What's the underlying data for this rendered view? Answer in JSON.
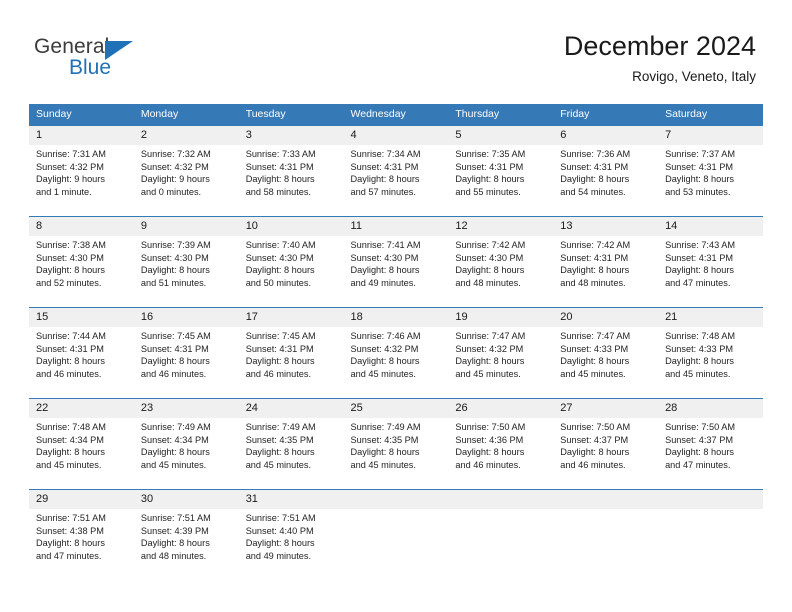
{
  "brand": {
    "name_part1": "General",
    "name_part2": "Blue",
    "accent_color": "#1f71b8",
    "triangle_icon": "triangle-icon"
  },
  "header": {
    "title": "December 2024",
    "subtitle": "Rovigo, Veneto, Italy"
  },
  "calendar": {
    "header_bg": "#3679b7",
    "daynum_bg": "#f0f0f0",
    "weekdays": [
      "Sunday",
      "Monday",
      "Tuesday",
      "Wednesday",
      "Thursday",
      "Friday",
      "Saturday"
    ],
    "weeks": [
      [
        {
          "day": "1",
          "sunrise": "Sunrise: 7:31 AM",
          "sunset": "Sunset: 4:32 PM",
          "daylight_line1": "Daylight: 9 hours",
          "daylight_line2": "and 1 minute."
        },
        {
          "day": "2",
          "sunrise": "Sunrise: 7:32 AM",
          "sunset": "Sunset: 4:32 PM",
          "daylight_line1": "Daylight: 9 hours",
          "daylight_line2": "and 0 minutes."
        },
        {
          "day": "3",
          "sunrise": "Sunrise: 7:33 AM",
          "sunset": "Sunset: 4:31 PM",
          "daylight_line1": "Daylight: 8 hours",
          "daylight_line2": "and 58 minutes."
        },
        {
          "day": "4",
          "sunrise": "Sunrise: 7:34 AM",
          "sunset": "Sunset: 4:31 PM",
          "daylight_line1": "Daylight: 8 hours",
          "daylight_line2": "and 57 minutes."
        },
        {
          "day": "5",
          "sunrise": "Sunrise: 7:35 AM",
          "sunset": "Sunset: 4:31 PM",
          "daylight_line1": "Daylight: 8 hours",
          "daylight_line2": "and 55 minutes."
        },
        {
          "day": "6",
          "sunrise": "Sunrise: 7:36 AM",
          "sunset": "Sunset: 4:31 PM",
          "daylight_line1": "Daylight: 8 hours",
          "daylight_line2": "and 54 minutes."
        },
        {
          "day": "7",
          "sunrise": "Sunrise: 7:37 AM",
          "sunset": "Sunset: 4:31 PM",
          "daylight_line1": "Daylight: 8 hours",
          "daylight_line2": "and 53 minutes."
        }
      ],
      [
        {
          "day": "8",
          "sunrise": "Sunrise: 7:38 AM",
          "sunset": "Sunset: 4:30 PM",
          "daylight_line1": "Daylight: 8 hours",
          "daylight_line2": "and 52 minutes."
        },
        {
          "day": "9",
          "sunrise": "Sunrise: 7:39 AM",
          "sunset": "Sunset: 4:30 PM",
          "daylight_line1": "Daylight: 8 hours",
          "daylight_line2": "and 51 minutes."
        },
        {
          "day": "10",
          "sunrise": "Sunrise: 7:40 AM",
          "sunset": "Sunset: 4:30 PM",
          "daylight_line1": "Daylight: 8 hours",
          "daylight_line2": "and 50 minutes."
        },
        {
          "day": "11",
          "sunrise": "Sunrise: 7:41 AM",
          "sunset": "Sunset: 4:30 PM",
          "daylight_line1": "Daylight: 8 hours",
          "daylight_line2": "and 49 minutes."
        },
        {
          "day": "12",
          "sunrise": "Sunrise: 7:42 AM",
          "sunset": "Sunset: 4:30 PM",
          "daylight_line1": "Daylight: 8 hours",
          "daylight_line2": "and 48 minutes."
        },
        {
          "day": "13",
          "sunrise": "Sunrise: 7:42 AM",
          "sunset": "Sunset: 4:31 PM",
          "daylight_line1": "Daylight: 8 hours",
          "daylight_line2": "and 48 minutes."
        },
        {
          "day": "14",
          "sunrise": "Sunrise: 7:43 AM",
          "sunset": "Sunset: 4:31 PM",
          "daylight_line1": "Daylight: 8 hours",
          "daylight_line2": "and 47 minutes."
        }
      ],
      [
        {
          "day": "15",
          "sunrise": "Sunrise: 7:44 AM",
          "sunset": "Sunset: 4:31 PM",
          "daylight_line1": "Daylight: 8 hours",
          "daylight_line2": "and 46 minutes."
        },
        {
          "day": "16",
          "sunrise": "Sunrise: 7:45 AM",
          "sunset": "Sunset: 4:31 PM",
          "daylight_line1": "Daylight: 8 hours",
          "daylight_line2": "and 46 minutes."
        },
        {
          "day": "17",
          "sunrise": "Sunrise: 7:45 AM",
          "sunset": "Sunset: 4:31 PM",
          "daylight_line1": "Daylight: 8 hours",
          "daylight_line2": "and 46 minutes."
        },
        {
          "day": "18",
          "sunrise": "Sunrise: 7:46 AM",
          "sunset": "Sunset: 4:32 PM",
          "daylight_line1": "Daylight: 8 hours",
          "daylight_line2": "and 45 minutes."
        },
        {
          "day": "19",
          "sunrise": "Sunrise: 7:47 AM",
          "sunset": "Sunset: 4:32 PM",
          "daylight_line1": "Daylight: 8 hours",
          "daylight_line2": "and 45 minutes."
        },
        {
          "day": "20",
          "sunrise": "Sunrise: 7:47 AM",
          "sunset": "Sunset: 4:33 PM",
          "daylight_line1": "Daylight: 8 hours",
          "daylight_line2": "and 45 minutes."
        },
        {
          "day": "21",
          "sunrise": "Sunrise: 7:48 AM",
          "sunset": "Sunset: 4:33 PM",
          "daylight_line1": "Daylight: 8 hours",
          "daylight_line2": "and 45 minutes."
        }
      ],
      [
        {
          "day": "22",
          "sunrise": "Sunrise: 7:48 AM",
          "sunset": "Sunset: 4:34 PM",
          "daylight_line1": "Daylight: 8 hours",
          "daylight_line2": "and 45 minutes."
        },
        {
          "day": "23",
          "sunrise": "Sunrise: 7:49 AM",
          "sunset": "Sunset: 4:34 PM",
          "daylight_line1": "Daylight: 8 hours",
          "daylight_line2": "and 45 minutes."
        },
        {
          "day": "24",
          "sunrise": "Sunrise: 7:49 AM",
          "sunset": "Sunset: 4:35 PM",
          "daylight_line1": "Daylight: 8 hours",
          "daylight_line2": "and 45 minutes."
        },
        {
          "day": "25",
          "sunrise": "Sunrise: 7:49 AM",
          "sunset": "Sunset: 4:35 PM",
          "daylight_line1": "Daylight: 8 hours",
          "daylight_line2": "and 45 minutes."
        },
        {
          "day": "26",
          "sunrise": "Sunrise: 7:50 AM",
          "sunset": "Sunset: 4:36 PM",
          "daylight_line1": "Daylight: 8 hours",
          "daylight_line2": "and 46 minutes."
        },
        {
          "day": "27",
          "sunrise": "Sunrise: 7:50 AM",
          "sunset": "Sunset: 4:37 PM",
          "daylight_line1": "Daylight: 8 hours",
          "daylight_line2": "and 46 minutes."
        },
        {
          "day": "28",
          "sunrise": "Sunrise: 7:50 AM",
          "sunset": "Sunset: 4:37 PM",
          "daylight_line1": "Daylight: 8 hours",
          "daylight_line2": "and 47 minutes."
        }
      ],
      [
        {
          "day": "29",
          "sunrise": "Sunrise: 7:51 AM",
          "sunset": "Sunset: 4:38 PM",
          "daylight_line1": "Daylight: 8 hours",
          "daylight_line2": "and 47 minutes."
        },
        {
          "day": "30",
          "sunrise": "Sunrise: 7:51 AM",
          "sunset": "Sunset: 4:39 PM",
          "daylight_line1": "Daylight: 8 hours",
          "daylight_line2": "and 48 minutes."
        },
        {
          "day": "31",
          "sunrise": "Sunrise: 7:51 AM",
          "sunset": "Sunset: 4:40 PM",
          "daylight_line1": "Daylight: 8 hours",
          "daylight_line2": "and 49 minutes."
        },
        {
          "day": "",
          "sunrise": "",
          "sunset": "",
          "daylight_line1": "",
          "daylight_line2": ""
        },
        {
          "day": "",
          "sunrise": "",
          "sunset": "",
          "daylight_line1": "",
          "daylight_line2": ""
        },
        {
          "day": "",
          "sunrise": "",
          "sunset": "",
          "daylight_line1": "",
          "daylight_line2": ""
        },
        {
          "day": "",
          "sunrise": "",
          "sunset": "",
          "daylight_line1": "",
          "daylight_line2": ""
        }
      ]
    ]
  }
}
